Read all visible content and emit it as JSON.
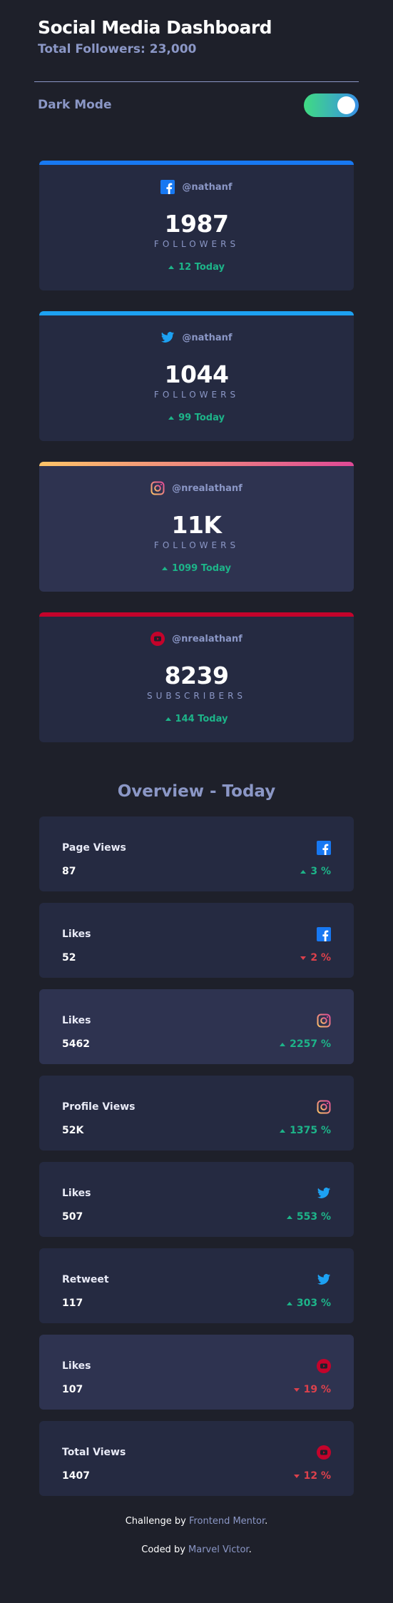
{
  "header": {
    "title": "Social Media Dashboard",
    "total_followers": "Total Followers: 23,000"
  },
  "mode": {
    "label": "Dark Mode",
    "enabled": true
  },
  "colors": {
    "facebook": "#1778f2",
    "twitter": "#1da1f2",
    "instagram_start": "#fdc468",
    "instagram_end": "#df4996",
    "youtube": "#c4032b",
    "up": "#1db489",
    "down": "#dc414c"
  },
  "cards": [
    {
      "network": "facebook",
      "icon": "facebook-icon",
      "handle": "@nathanf",
      "count": "1987",
      "unit": "FOLLOWERS",
      "change": "12 Today",
      "trend": "up"
    },
    {
      "network": "twitter",
      "icon": "twitter-icon",
      "handle": "@nathanf",
      "count": "1044",
      "unit": "FOLLOWERS",
      "change": "99 Today",
      "trend": "up"
    },
    {
      "network": "instagram",
      "icon": "instagram-icon",
      "handle": "@nrealathanf",
      "count": "11K",
      "unit": "FOLLOWERS",
      "change": "1099 Today",
      "trend": "up"
    },
    {
      "network": "youtube",
      "icon": "youtube-icon",
      "handle": "@nrealathanf",
      "count": "8239",
      "unit": "SUBSCRIBERS",
      "change": "144 Today",
      "trend": "up"
    }
  ],
  "overview": {
    "title": "Overview - Today",
    "items": [
      {
        "label": "Page Views",
        "icon": "facebook-icon",
        "value": "87",
        "pct": "3 %",
        "trend": "up"
      },
      {
        "label": "Likes",
        "icon": "facebook-icon",
        "value": "52",
        "pct": "2 %",
        "trend": "down"
      },
      {
        "label": "Likes",
        "icon": "instagram-icon",
        "value": "5462",
        "pct": "2257 %",
        "trend": "up"
      },
      {
        "label": "Profile Views",
        "icon": "instagram-icon",
        "value": "52K",
        "pct": "1375 %",
        "trend": "up"
      },
      {
        "label": "Likes",
        "icon": "twitter-icon",
        "value": "507",
        "pct": "553 %",
        "trend": "up"
      },
      {
        "label": "Retweet",
        "icon": "twitter-icon",
        "value": "117",
        "pct": "303 %",
        "trend": "up"
      },
      {
        "label": "Likes",
        "icon": "youtube-icon",
        "value": "107",
        "pct": "19 %",
        "trend": "down"
      },
      {
        "label": "Total Views",
        "icon": "youtube-icon",
        "value": "1407",
        "pct": "12 %",
        "trend": "down"
      }
    ]
  },
  "footer": {
    "challenge_prefix": "Challenge by ",
    "challenge_link": "Frontend Mentor",
    "challenge_suffix": ".",
    "coded_prefix": "Coded by ",
    "coded_link": "Marvel Victor",
    "coded_suffix": "."
  }
}
